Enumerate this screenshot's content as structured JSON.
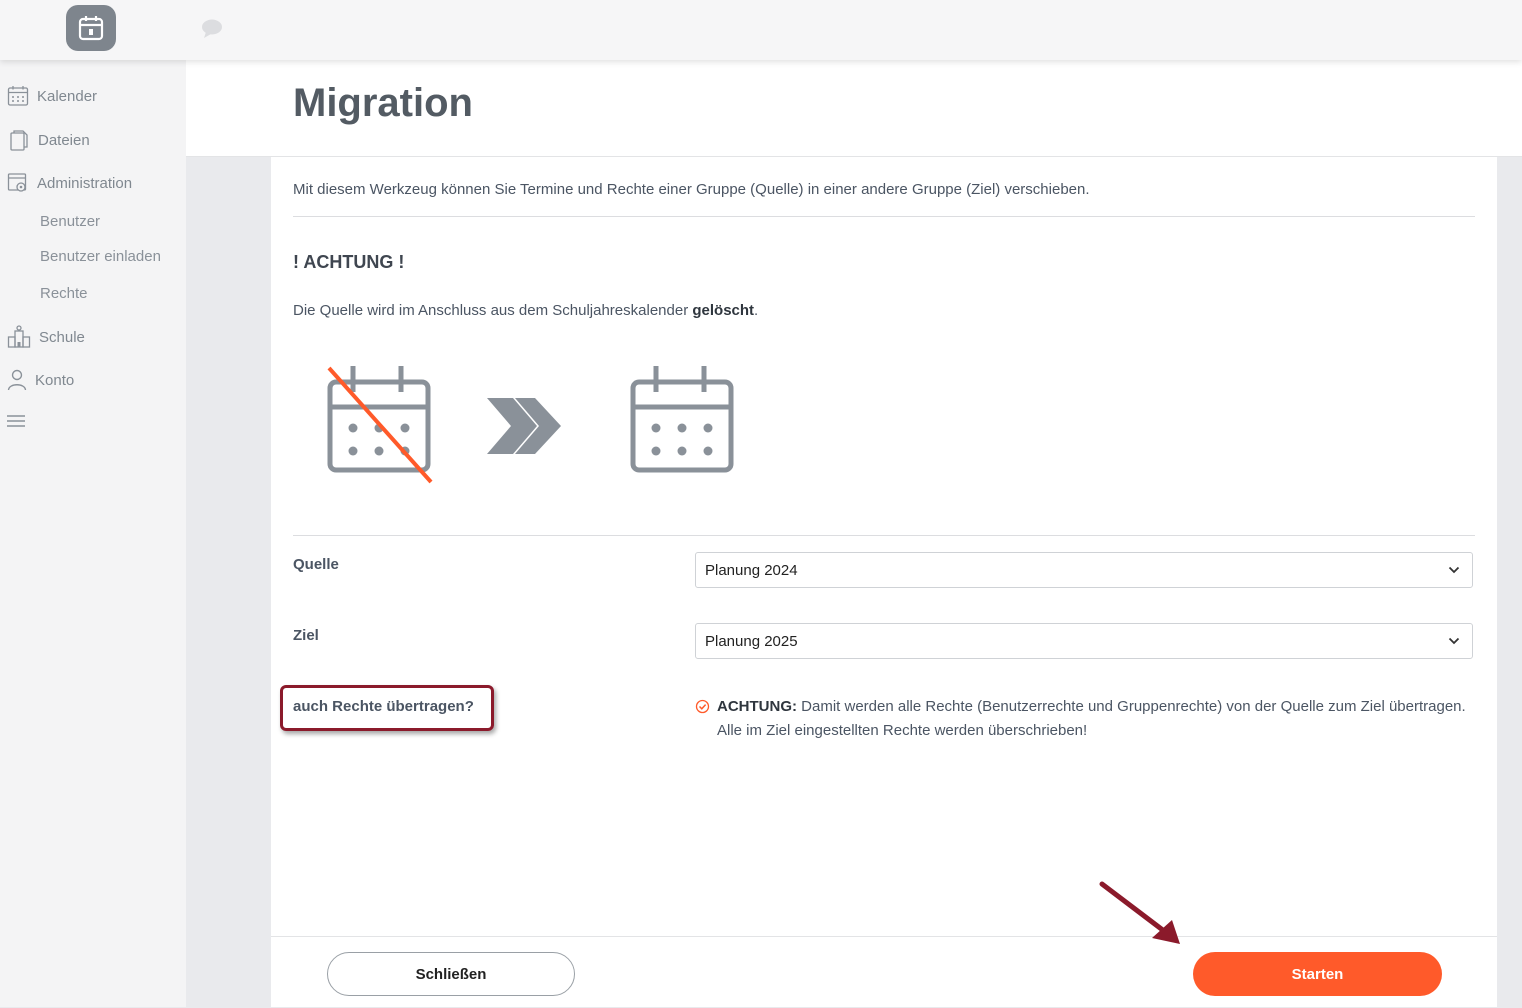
{
  "sidebar": {
    "items": [
      {
        "label": "Kalender",
        "icon": "calendar-icon"
      },
      {
        "label": "Dateien",
        "icon": "files-icon"
      },
      {
        "label": "Administration",
        "icon": "admin-icon"
      },
      {
        "label": "Schule",
        "icon": "school-icon"
      },
      {
        "label": "Konto",
        "icon": "user-icon"
      }
    ],
    "subitems": [
      "Benutzer",
      "Benutzer einladen",
      "Rechte"
    ]
  },
  "page": {
    "title": "Migration"
  },
  "content": {
    "intro": "Mit diesem Werkzeug können Sie Termine und Rechte einer Gruppe (Quelle) in einer andere Gruppe (Ziel) verschieben.",
    "warning_title": "! ACHTUNG !",
    "warning_text_before": "Die Quelle wird im Anschluss aus dem Schuljahreskalender ",
    "warning_text_bold": "gelöscht",
    "warning_text_after": "."
  },
  "form": {
    "source_label": "Quelle",
    "source_value": "Planung 2024",
    "target_label": "Ziel",
    "target_value": "Planung 2025",
    "rights_label": "auch Rechte übertragen?",
    "rights_notice_bold": "ACHTUNG:",
    "rights_notice_text": " Damit werden alle Rechte (Benutzerrechte und Gruppenrechte) von der Quelle zum Ziel übertragen. Alle im Ziel eingestellten Rechte werden überschrieben!"
  },
  "footer": {
    "close_label": "Schließen",
    "start_label": "Starten"
  },
  "colors": {
    "accent": "#ff5a2a",
    "annotation": "#8b1a2b",
    "icon_gray": "#8a9199"
  }
}
